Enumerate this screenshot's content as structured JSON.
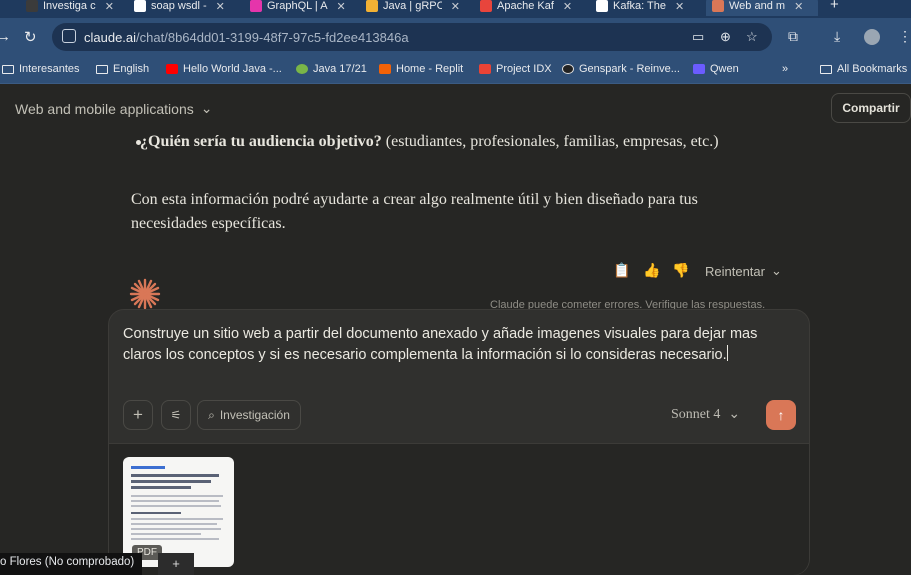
{
  "browser": {
    "tabs": [
      {
        "title": "Investiga cl",
        "color": "#3b3b3b"
      },
      {
        "title": "soap wsdl -",
        "color": "#ffffff"
      },
      {
        "title": "GraphQL | A",
        "color": "#e535ab"
      },
      {
        "title": "Java | gRPC",
        "color": "#f2b134"
      },
      {
        "title": "Apache Kaf",
        "color": "#e8453c"
      },
      {
        "title": "Kafka: The",
        "color": "#ffffff"
      },
      {
        "title": "Web and m",
        "color": "#d97757"
      }
    ],
    "url_host": "claude.ai",
    "url_path": "/chat/8b64dd01-3199-48f7-97c5-fd2ee413846a",
    "bookmarks": [
      {
        "label": "Interesantes",
        "kind": "folder"
      },
      {
        "label": "English",
        "kind": "folder"
      },
      {
        "label": "Hello World Java -...",
        "kind": "youtube"
      },
      {
        "label": "Java 17/21",
        "kind": "site"
      },
      {
        "label": "Home - Replit",
        "kind": "site"
      },
      {
        "label": "Project IDX",
        "kind": "site"
      },
      {
        "label": "Genspark - Reinve...",
        "kind": "site"
      },
      {
        "label": "Qwen",
        "kind": "site"
      }
    ],
    "more_bookmarks": "»",
    "all_bookmarks": "All Bookmarks"
  },
  "header": {
    "project_title": "Web and mobile applications",
    "share_label": "Compartir"
  },
  "conversation": {
    "bullet_bold": "¿Quién sería tu audiencia objetivo?",
    "bullet_rest": " (estudiantes, profesionales, familias, empresas, etc.)",
    "paragraph": "Con esta información podré ayudarte a crear algo realmente útil y bien diseñado para tus necesidades específicas.",
    "retry_label": "Reintentar",
    "disclaimer": "Claude puede cometer errores. Verifique las respuestas."
  },
  "composer": {
    "prompt_text": "Construye un sitio web a partir del documento anexado y añade imagenes visuales para dejar mas claros los conceptos y si es necesario complementa la información si lo consideras necesario.",
    "research_label": "Investigación",
    "model_label": "Sonnet 4",
    "attachment_tag": "PDF"
  },
  "status": {
    "user_chip": "o Flores (No comprobado)"
  },
  "colors": {
    "accent": "#d97757",
    "background": "#262624",
    "browser_chrome": "#2f4f77"
  }
}
